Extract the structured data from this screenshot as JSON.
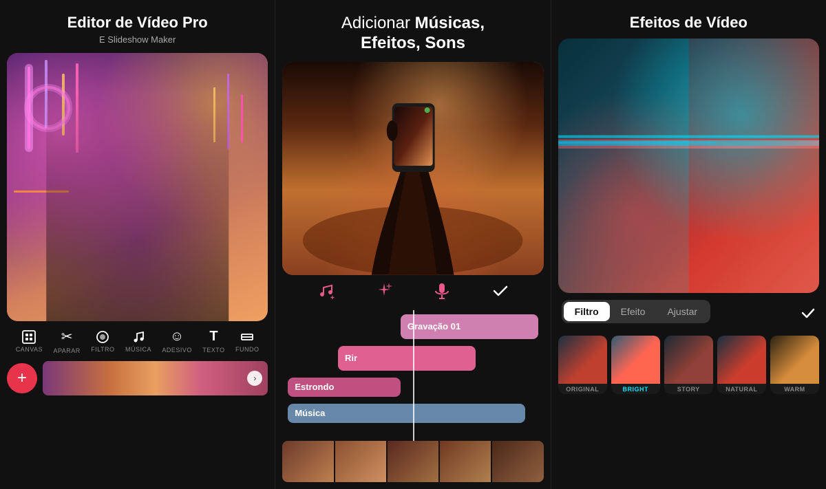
{
  "panels": [
    {
      "id": "panel1",
      "title_line1": "Editor de Vídeo Pro",
      "title_bold": "Editor de Vídeo Pro",
      "subtitle": "E Slideshow Maker",
      "toolbar_items": [
        {
          "icon": "⬜",
          "label": "CANVAS"
        },
        {
          "icon": "✂",
          "label": "APARAR"
        },
        {
          "icon": "○",
          "label": "FILTRO"
        },
        {
          "icon": "♩",
          "label": "MÚSICA"
        },
        {
          "icon": "☺",
          "label": "ADESIVO"
        },
        {
          "icon": "T",
          "label": "TEXTO"
        },
        {
          "icon": "≡",
          "label": "FUNDO"
        }
      ],
      "add_button": "+",
      "filmstrip_arrow": "›"
    },
    {
      "id": "panel2",
      "title": "Adicionar ",
      "title_bold": "Músicas, Efeitos, Sons",
      "title_line1": "Adicionar ",
      "title_line2": "Músicas,",
      "title_line3": "Efeitos, Sons",
      "controls": [
        {
          "icon": "♪+",
          "label": "music-add"
        },
        {
          "icon": "✳",
          "label": "effects"
        },
        {
          "icon": "🎤",
          "label": "mic"
        },
        {
          "icon": "✓",
          "label": "confirm"
        }
      ],
      "tracks": [
        {
          "label": "Gravação 01",
          "class": "track-pink-light",
          "offset": "right"
        },
        {
          "label": "Rir",
          "class": "track-pink",
          "offset": "mid"
        },
        {
          "label": "Estrondo",
          "class": "track-dark-pink",
          "offset": "left"
        },
        {
          "label": "Música",
          "class": "track-blue",
          "offset": "full"
        }
      ]
    },
    {
      "id": "panel3",
      "title": "Efeitos de Vídeo",
      "filter_tabs": [
        {
          "label": "Filtro",
          "active": true
        },
        {
          "label": "Efeito",
          "active": false
        },
        {
          "label": "Ajustar",
          "active": false
        }
      ],
      "confirm_icon": "✓",
      "filters": [
        {
          "name": "ORIGINAL",
          "class": "f-original",
          "color": "#888"
        },
        {
          "name": "BrIGhT",
          "class": "f-bright",
          "color": "#00e5ff"
        },
        {
          "name": "Story",
          "class": "f-story",
          "color": "#888"
        },
        {
          "name": "NATURAL",
          "class": "f-natural",
          "color": "#888"
        },
        {
          "name": "WARM",
          "class": "f-warm",
          "color": "#888"
        }
      ]
    }
  ]
}
